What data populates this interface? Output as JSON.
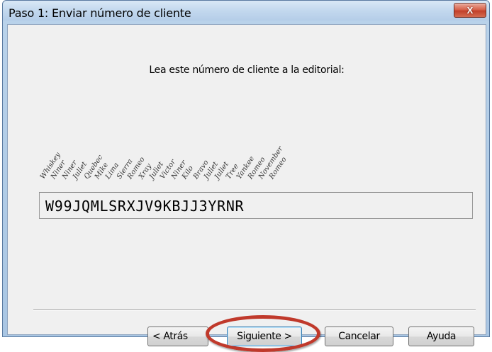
{
  "window": {
    "title": "Paso 1: Enviar número de cliente",
    "close_label": "X"
  },
  "main": {
    "instruction": "Lea este número de cliente a la editorial:",
    "phonetic": [
      "Whiskey",
      "Niner",
      "Niner",
      "Juliet",
      "Quebec",
      "Mike",
      "Lima",
      "Sierra",
      "Romeo",
      "Xray",
      "Juliet",
      "Victor",
      "Niner",
      "Kilo",
      "Bravo",
      "Juliet",
      "Juliet",
      "Tree",
      "Yankee",
      "Romeo",
      "November",
      "Romeo"
    ],
    "code": "W99JQMLSRXJV9KBJJ3YRNR"
  },
  "buttons": {
    "back": "< Atrás",
    "next": "Siguiente >",
    "cancel": "Cancelar",
    "help": "Ayuda"
  },
  "colors": {
    "highlight": "#c0392b"
  }
}
